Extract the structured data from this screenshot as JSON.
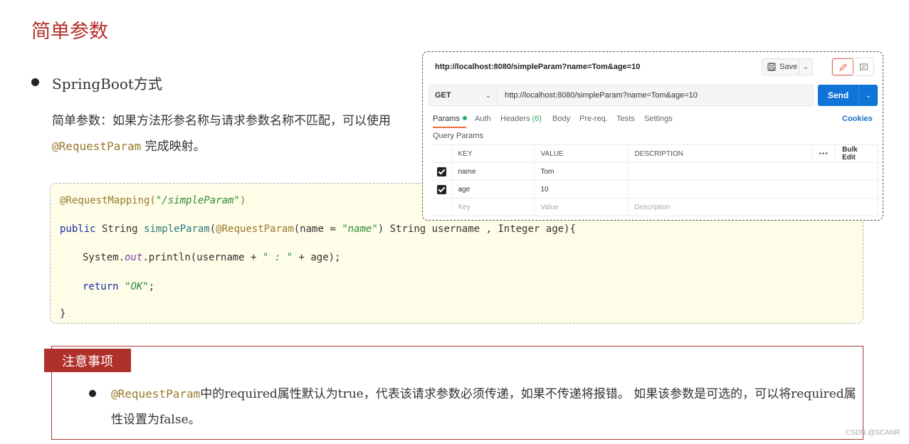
{
  "page": {
    "title": "简单参数",
    "section_heading": "SpringBoot方式",
    "desc_part1": "简单参数：如果方法形参名称与请求参数名称不匹配，可以使用 ",
    "desc_annotation": "@RequestParam",
    "desc_part2": " 完成映射。"
  },
  "code": {
    "line1_anno": "@RequestMapping(",
    "line1_str": "\"/simpleParam\"",
    "line1_end": ")",
    "line2_kw": "public",
    "line2_type": " String ",
    "line2_method": "simpleParam",
    "line2_paren": "(",
    "line2_anno": "@RequestParam",
    "line2_args1": "(name = ",
    "line2_str": "\"name\"",
    "line2_args2": ") String username , Integer age){",
    "line3_a": "System.",
    "line3_field": "out",
    "line3_b": ".println(username + ",
    "line3_str": "\" : \"",
    "line3_c": " + age);",
    "line4_kw": "return",
    "line4_sp": " ",
    "line4_str": "\"OK\"",
    "line4_end": ";",
    "line5": "}"
  },
  "postman": {
    "url_title": "http://localhost:8080/simpleParam?name=Tom&age=10",
    "save_label": "Save",
    "method": "GET",
    "request_url": "http://localhost:8080/simpleParam?name=Tom&age=10",
    "send_label": "Send",
    "tabs": {
      "params": "Params",
      "auth": "Auth",
      "headers": "Headers",
      "headers_count": "(6)",
      "body": "Body",
      "prereq": "Pre-req.",
      "tests": "Tests",
      "settings": "Settings",
      "cookies": "Cookies"
    },
    "query_params_label": "Query Params",
    "table": {
      "col_key": "KEY",
      "col_value": "VALUE",
      "col_description": "DESCRIPTION",
      "more": "•••",
      "bulk_edit": "Bulk Edit",
      "rows": [
        {
          "key": "name",
          "value": "Tom",
          "description": "",
          "checked": true
        },
        {
          "key": "age",
          "value": "10",
          "description": "",
          "checked": true
        }
      ],
      "placeholder_key": "Key",
      "placeholder_value": "Value",
      "placeholder_description": "Description"
    },
    "accent_color": "#0f73d8",
    "icons": [
      "save-icon",
      "chevron-down-icon",
      "edit-pencil-icon",
      "comment-icon",
      "checkbox-checked-icon"
    ]
  },
  "notice": {
    "title": "注意事项",
    "annotation": "@RequestParam",
    "text": "中的required属性默认为true，代表该请求参数必须传递，如果不传递将报错。 如果该参数是可选的，可以将required属性设置为false。"
  },
  "watermark": "CSDN @SCANR"
}
